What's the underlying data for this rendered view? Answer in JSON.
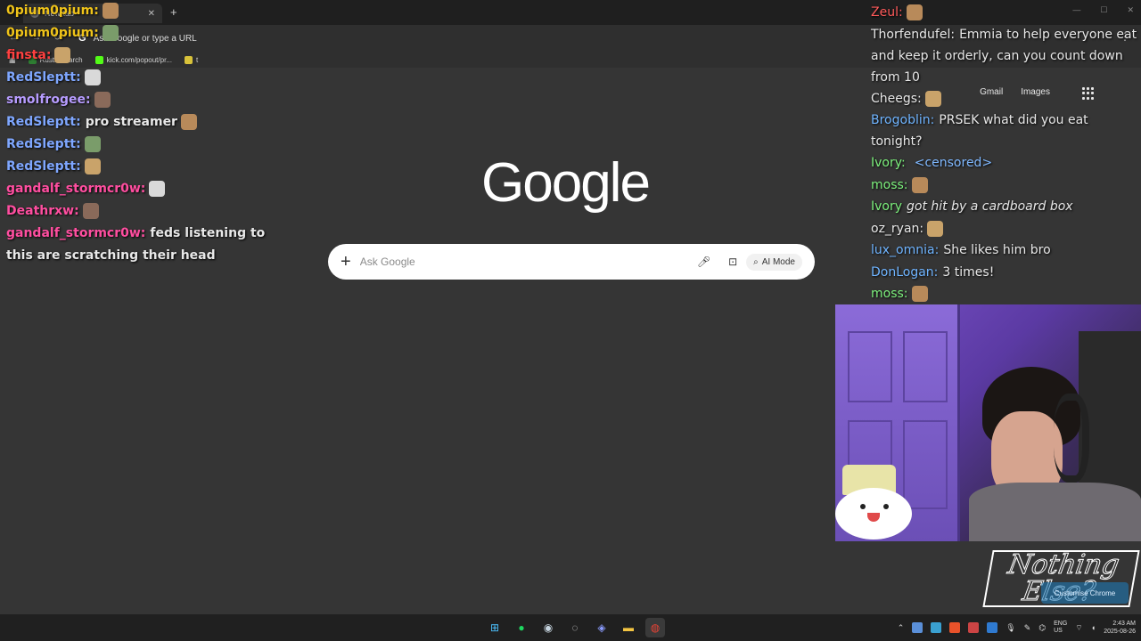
{
  "browser": {
    "tab_title": "New tab",
    "new_tab_glyph": "+",
    "omnibox_text": "Ask Google or type a URL",
    "bookmarks": [
      {
        "label": "RustleSearch",
        "color": "#2e7d32"
      },
      {
        "label": "kick.com/popout/pr...",
        "color": "#53fc18"
      },
      {
        "label": "t",
        "color": "#d8c23a"
      }
    ]
  },
  "ntp": {
    "gmail": "Gmail",
    "images": "Images",
    "logo": "Google",
    "search_placeholder": "Ask Google",
    "ai_mode": "AI Mode"
  },
  "chat_left": [
    {
      "user": "0pium0pium:",
      "color": "#f0c419",
      "text": ""
    },
    {
      "user": "0pium0pium:",
      "color": "#f0c419",
      "text": ""
    },
    {
      "user": "finsta:",
      "color": "#ff4040",
      "text": ""
    },
    {
      "user": "RedSleptt:",
      "color": "#7fa7ff",
      "text": ""
    },
    {
      "user": "smolfrogee:",
      "color": "#b79cff",
      "text": ""
    },
    {
      "user": "RedSleptt:",
      "color": "#7fa7ff",
      "text": "pro streamer"
    },
    {
      "user": "RedSleptt:",
      "color": "#7fa7ff",
      "text": ""
    },
    {
      "user": "RedSleptt:",
      "color": "#7fa7ff",
      "text": ""
    },
    {
      "user": "gandalf_stormcr0w:",
      "color": "#ff4ea0",
      "text": ""
    },
    {
      "user": "Deathrxw:",
      "color": "#ff4ea0",
      "text": ""
    },
    {
      "user": "gandalf_stormcr0w:",
      "color": "#ff4ea0",
      "text": "feds listening to this are scratching their head"
    }
  ],
  "chat_right": [
    {
      "user": "Zeul:",
      "color": "#ff5a5a",
      "text": ""
    },
    {
      "user": "Thorfendufel:",
      "color": "#e8e8e8",
      "text": "Emmia to help everyone eat and keep it orderly, can you count down from 10"
    },
    {
      "user": "Cheegs:",
      "color": "#e8e8e8",
      "text": ""
    },
    {
      "user": "Brogoblin:",
      "color": "#6fb4ff",
      "text": "PRSEK what did you eat tonight?"
    },
    {
      "user": "Ivory:",
      "color": "#7cf07c",
      "text": "<censored>"
    },
    {
      "user": "moss:",
      "color": "#7cf07c",
      "text": ""
    },
    {
      "user": "Ivory",
      "color": "#7cf07c",
      "text": "got hit by a cardboard box"
    },
    {
      "user": "oz_ryan:",
      "color": "#e8e8e8",
      "text": ""
    },
    {
      "user": "lux_omnia:",
      "color": "#6fb4ff",
      "text": "She likes him bro"
    },
    {
      "user": "DonLogan:",
      "color": "#6fb4ff",
      "text": "3 times!"
    },
    {
      "user": "moss:",
      "color": "#7cf07c",
      "text": ""
    }
  ],
  "overlay": {
    "brand": "Nothing Else?",
    "customise": "Customise Chrome"
  },
  "taskbar": {
    "apps": [
      "start-icon",
      "spotify-icon",
      "steam-icon",
      "obs-icon",
      "discord-icon",
      "file-explorer-icon",
      "chrome-icon"
    ],
    "lang_top": "ENG",
    "lang_bottom": "US",
    "time": "2:43 AM",
    "date": "2025-08-26"
  }
}
